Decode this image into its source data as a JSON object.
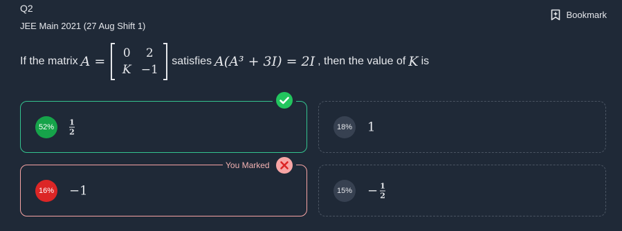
{
  "header": {
    "question_number": "Q2",
    "exam": "JEE Main 2021 (27 Aug Shift 1)",
    "bookmark_label": "Bookmark",
    "bookmark_icon": "bookmark-plus-icon"
  },
  "question": {
    "text_before": "If the matrix",
    "matrix_name": "A",
    "matrix": [
      [
        "0",
        "2"
      ],
      [
        "K",
        "−1"
      ]
    ],
    "text_middle": "satisfies",
    "equation": "A(A³ + 3I) = 2I",
    "text_after": ", then the value of",
    "unknown": "K",
    "text_end": "is"
  },
  "options": [
    {
      "percent": "52%",
      "value": "1/2",
      "numerator": "1",
      "denominator": "2",
      "sign": "",
      "status": "correct"
    },
    {
      "percent": "18%",
      "value": "1",
      "sign": "",
      "status": "none"
    },
    {
      "percent": "16%",
      "value": "−1",
      "sign": "−",
      "status": "marked-wrong"
    },
    {
      "percent": "15%",
      "value": "−1/2",
      "numerator": "1",
      "denominator": "2",
      "sign": "−",
      "status": "none"
    }
  ],
  "markers": {
    "correct_icon": "check-circle-icon",
    "wrong_icon": "x-circle-icon",
    "you_marked_label": "You Marked"
  },
  "colors": {
    "background": "#1f2937",
    "correct": "#34c490",
    "wrong": "#f8a5a5",
    "percent_green": "#16a34a",
    "percent_red": "#dc2626"
  }
}
